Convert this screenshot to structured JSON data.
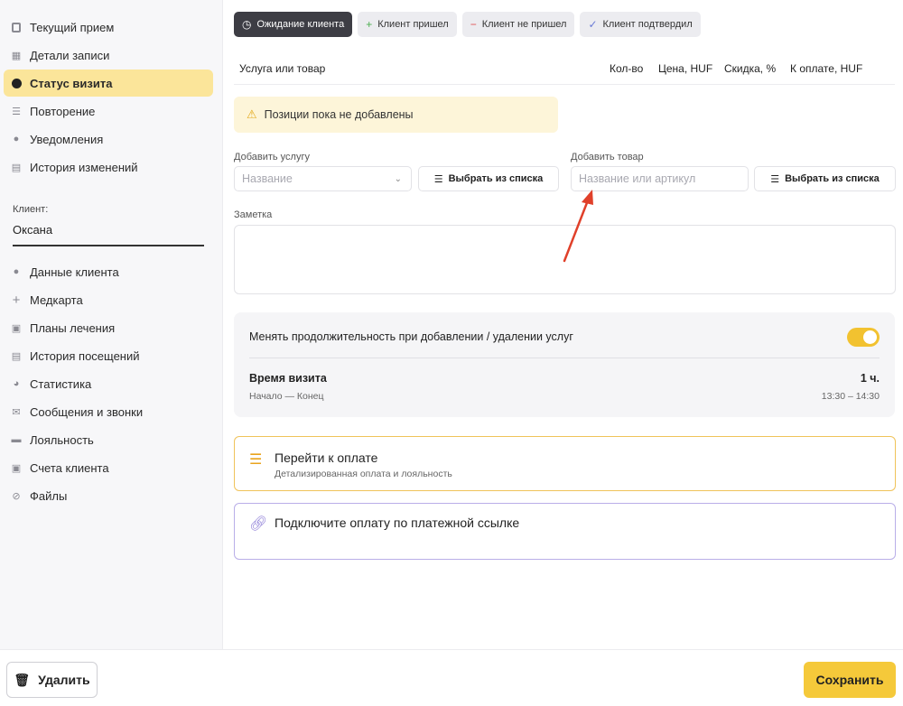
{
  "sidebar": {
    "nav_top": [
      {
        "label": "Текущий прием",
        "icon": "clipboard-icon"
      },
      {
        "label": "Детали записи",
        "icon": "calendar-icon"
      },
      {
        "label": "Статус визита",
        "icon": "clock-icon",
        "active": true
      },
      {
        "label": "Повторение",
        "icon": "list-icon"
      },
      {
        "label": "Уведомления",
        "icon": "chat-icon"
      },
      {
        "label": "История изменений",
        "icon": "document-icon"
      }
    ],
    "client_label": "Клиент:",
    "client_name": "Оксана",
    "nav_bottom": [
      {
        "label": "Данные клиента",
        "icon": "user-icon"
      },
      {
        "label": "Медкарта",
        "icon": "plus-icon"
      },
      {
        "label": "Планы лечения",
        "icon": "briefcase-icon"
      },
      {
        "label": "История посещений",
        "icon": "list-box-icon"
      },
      {
        "label": "Статистика",
        "icon": "pie-chart-icon"
      },
      {
        "label": "Сообщения и звонки",
        "icon": "mail-icon"
      },
      {
        "label": "Лояльность",
        "icon": "card-icon"
      },
      {
        "label": "Счета клиента",
        "icon": "wallet-icon"
      },
      {
        "label": "Файлы",
        "icon": "paperclip-icon"
      }
    ]
  },
  "status_buttons": [
    {
      "label": "Ожидание клиента",
      "icon": "clock-icon",
      "active": true
    },
    {
      "label": "Клиент пришел",
      "icon": "plus-icon"
    },
    {
      "label": "Клиент не пришел",
      "icon": "minus-icon"
    },
    {
      "label": "Клиент подтвердил",
      "icon": "check-icon"
    }
  ],
  "table": {
    "col_service": "Услуга или товар",
    "col_qty": "Кол-во",
    "col_price": "Цена, HUF",
    "col_discount": "Скидка, %",
    "col_total": "К оплате, HUF"
  },
  "notice": "Позиции пока не добавлены",
  "add_service": {
    "label": "Добавить услугу",
    "placeholder": "Название",
    "list_button": "Выбрать из списка"
  },
  "add_product": {
    "label": "Добавить товар",
    "placeholder": "Название или артикул",
    "list_button": "Выбрать из списка"
  },
  "note_label": "Заметка",
  "duration": {
    "toggle_label": "Менять продолжительность при добавлении / удалении услуг",
    "toggle_on": true,
    "visit_label": "Время визита",
    "visit_sub": "Начало — Конец",
    "visit_value": "1 ч.",
    "visit_time": "13:30 – 14:30"
  },
  "payment": {
    "title": "Перейти к оплате",
    "subtitle": "Детализированная оплата и лояльность"
  },
  "payment_link": {
    "title": "Подключите оплату по платежной ссылке"
  },
  "footer": {
    "delete_label": "Удалить",
    "save_label": "Сохранить"
  },
  "colors": {
    "accent": "#f5c93a",
    "active_nav": "#fbe59a",
    "annotation_arrow": "#e0402a"
  }
}
